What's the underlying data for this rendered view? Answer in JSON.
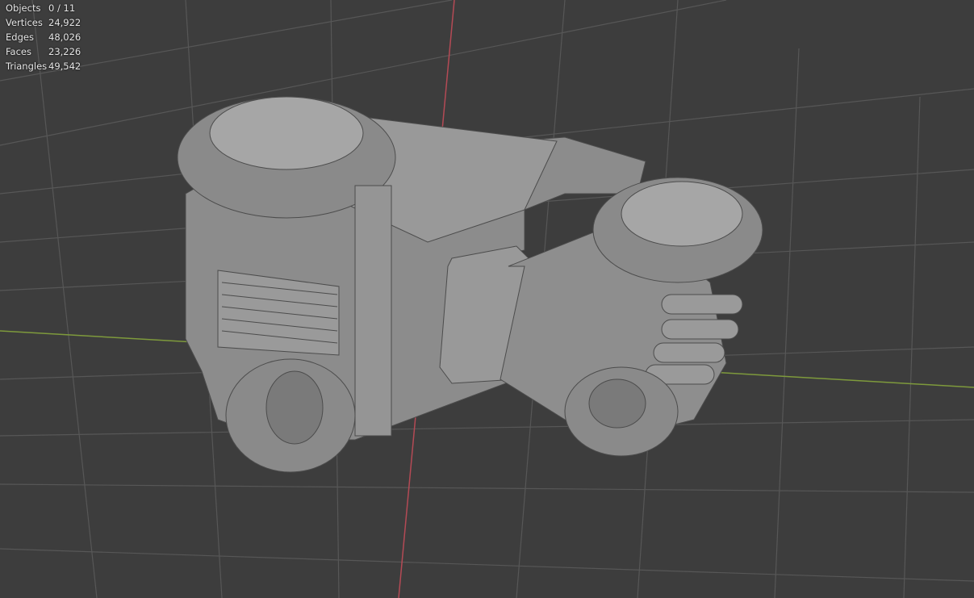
{
  "stats": [
    {
      "label": "Objects",
      "value": "0 / 11"
    },
    {
      "label": "Vertices",
      "value": "24,922"
    },
    {
      "label": "Edges",
      "value": "48,026"
    },
    {
      "label": "Faces",
      "value": "23,226"
    },
    {
      "label": "Triangles",
      "value": "49,542"
    }
  ],
  "colors": {
    "background": "#3d3d3d",
    "grid": "#575757",
    "x_axis": "#7e9a3c",
    "y_axis": "#b44a55",
    "mesh_base": "#8c8c8c",
    "mesh_wire": "#4c4c4c"
  }
}
